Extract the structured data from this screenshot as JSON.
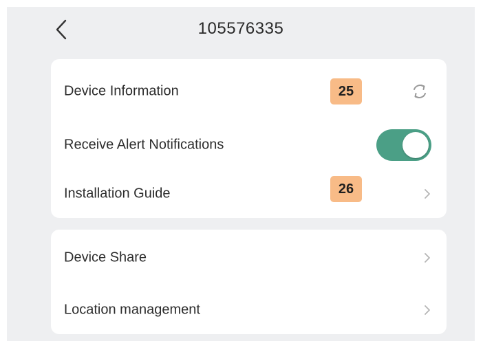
{
  "header": {
    "title": "105576335",
    "back_icon": "chevron-left-icon"
  },
  "settings_card": {
    "device_information": {
      "label": "Device Information",
      "badge": "25",
      "icon": "refresh-icon"
    },
    "alert_notifications": {
      "label": "Receive Alert Notifications",
      "toggle_on": true,
      "accent_color": "#4b9f86"
    },
    "installation_guide": {
      "label": "Installation Guide",
      "badge": "26",
      "icon": "chevron-right-icon"
    }
  },
  "sharing_card": {
    "device_share": {
      "label": "Device Share",
      "icon": "chevron-right-icon"
    },
    "location_management": {
      "label": "Location management",
      "icon": "chevron-right-icon"
    }
  },
  "colors": {
    "badge": "#f8bb87",
    "background": "#eeeff1"
  }
}
